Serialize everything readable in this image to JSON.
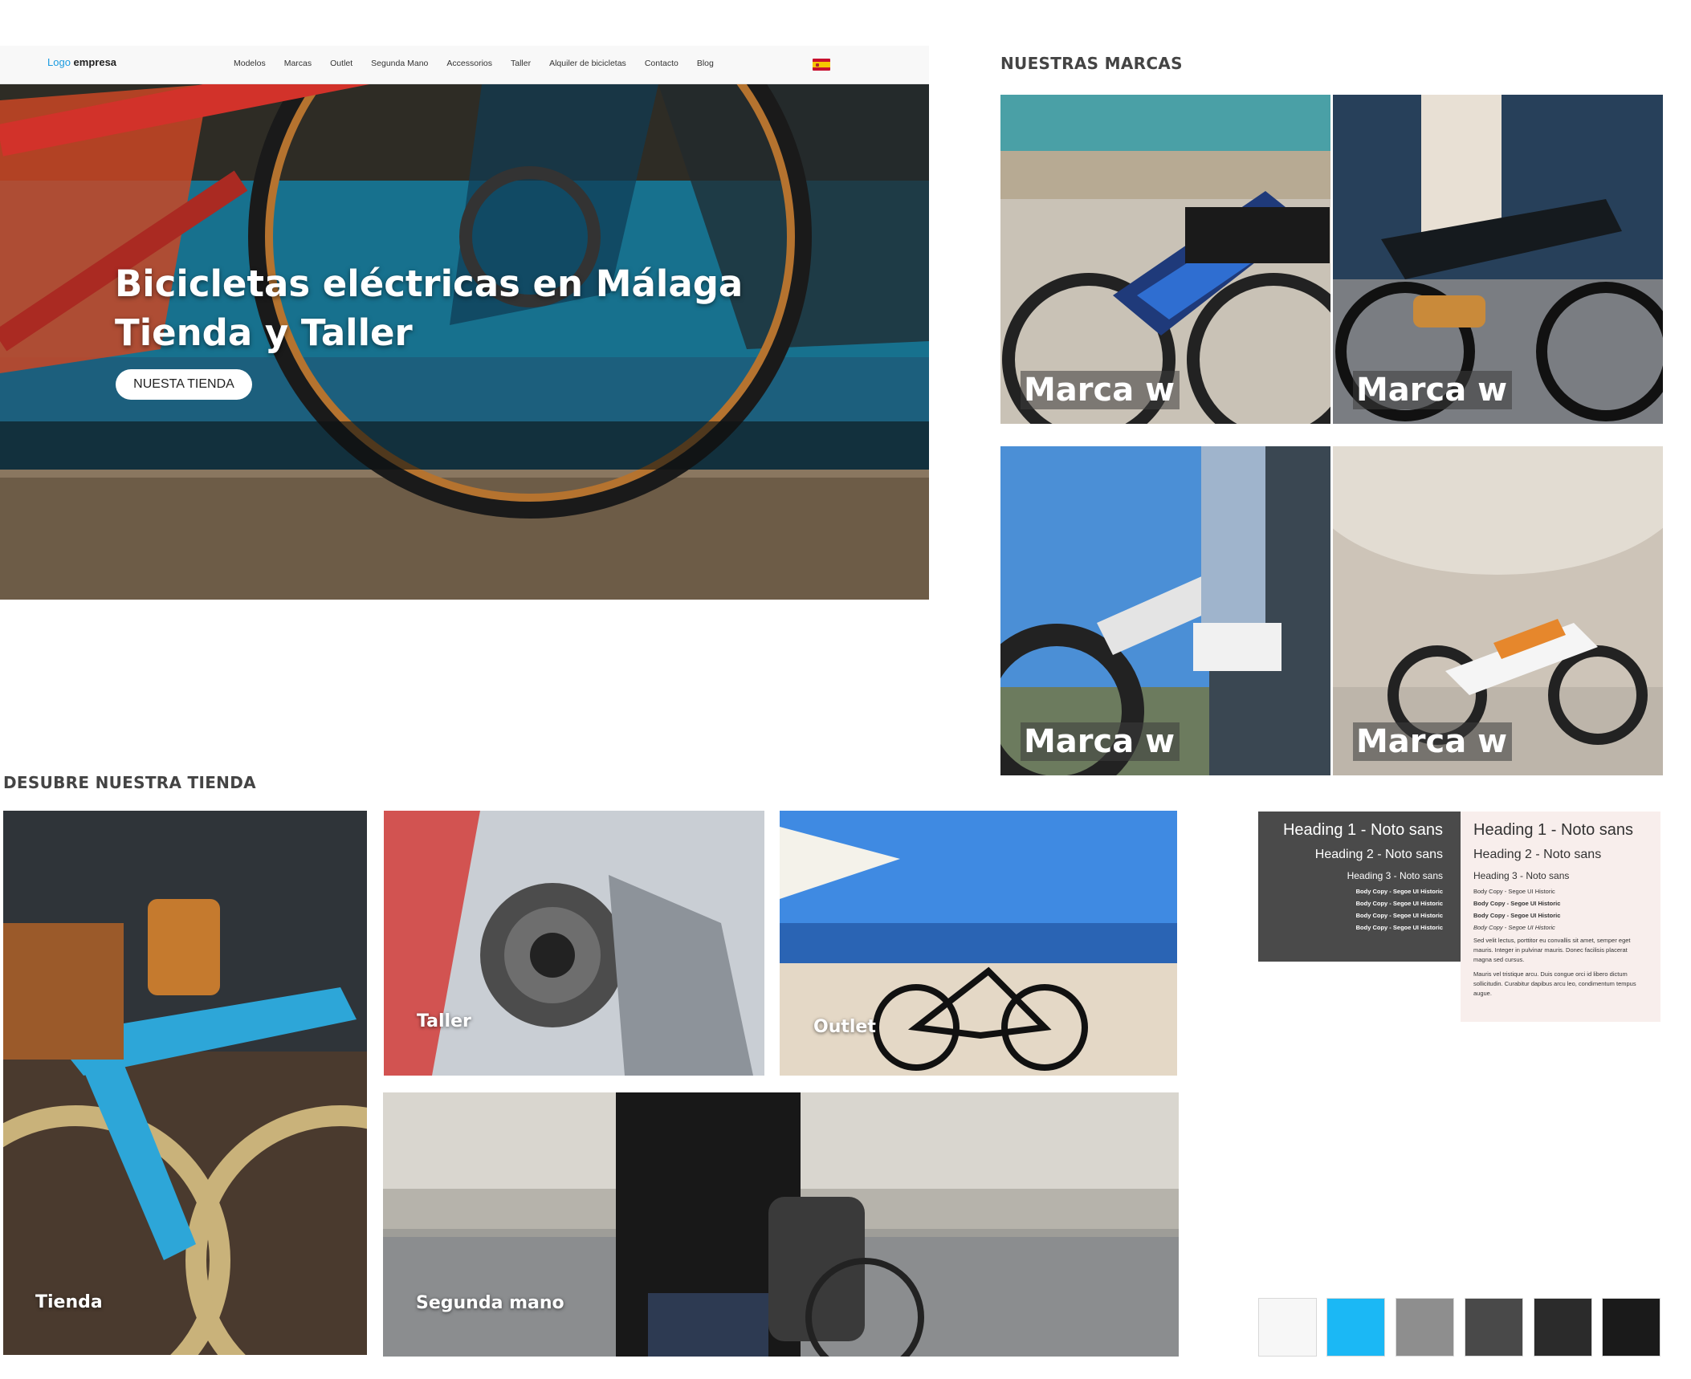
{
  "nav": {
    "logo_part1": "Logo",
    "logo_part2": "empresa",
    "items": [
      "Modelos",
      "Marcas",
      "Outlet",
      "Segunda Mano",
      "Accessorios",
      "Taller",
      "Alquiler de bicicletas",
      "Contacto",
      "Blog"
    ],
    "language_flag": "spain-flag-icon"
  },
  "hero": {
    "title_line1": "Bicicletas eléctricas en Málaga",
    "title_line2": "Tienda y Taller",
    "button_label": "NUESTA TIENDA"
  },
  "brands": {
    "title": "NUESTRAS MARCAS",
    "cards": [
      {
        "label": "Marca w"
      },
      {
        "label": "Marca w"
      },
      {
        "label": "Marca w"
      },
      {
        "label": "Marca w"
      }
    ]
  },
  "store": {
    "title": "DESUBRE NUESTRA TIENDA",
    "cards": [
      {
        "label": "Tienda"
      },
      {
        "label": "Taller"
      },
      {
        "label": "Outlet"
      },
      {
        "label": "Segunda mano"
      }
    ]
  },
  "typography": {
    "dark": {
      "h1": "Heading 1 - Noto sans",
      "h2": "Heading 2 - Noto sans",
      "h3": "Heading 3 - Noto sans",
      "body_prefix": "Body Copy -",
      "body_font": "Segoe UI Historic"
    },
    "light": {
      "h1": "Heading 1 - Noto sans",
      "h2": "Heading 2 - Noto sans",
      "h3": "Heading 3 - Noto sans",
      "body_prefix": "Body Copy -",
      "body_font": "Segoe UI Historic",
      "para1": "Sed velit lectus, porttitor eu convallis sit amet, semper eget mauris. Integer in pulvinar mauris. Donec facilisis placerat magna sed cursus.",
      "para2": "Mauris vel tristique arcu. Duis congue orci id libero dictum sollicitudin. Curabitur dapibus arcu leo, condimentum tempus augue."
    }
  },
  "palette": [
    "#f7f7f7",
    "#1bb8f5",
    "#8e8e8e",
    "#494949",
    "#2b2b2b",
    "#1a1a1a"
  ]
}
